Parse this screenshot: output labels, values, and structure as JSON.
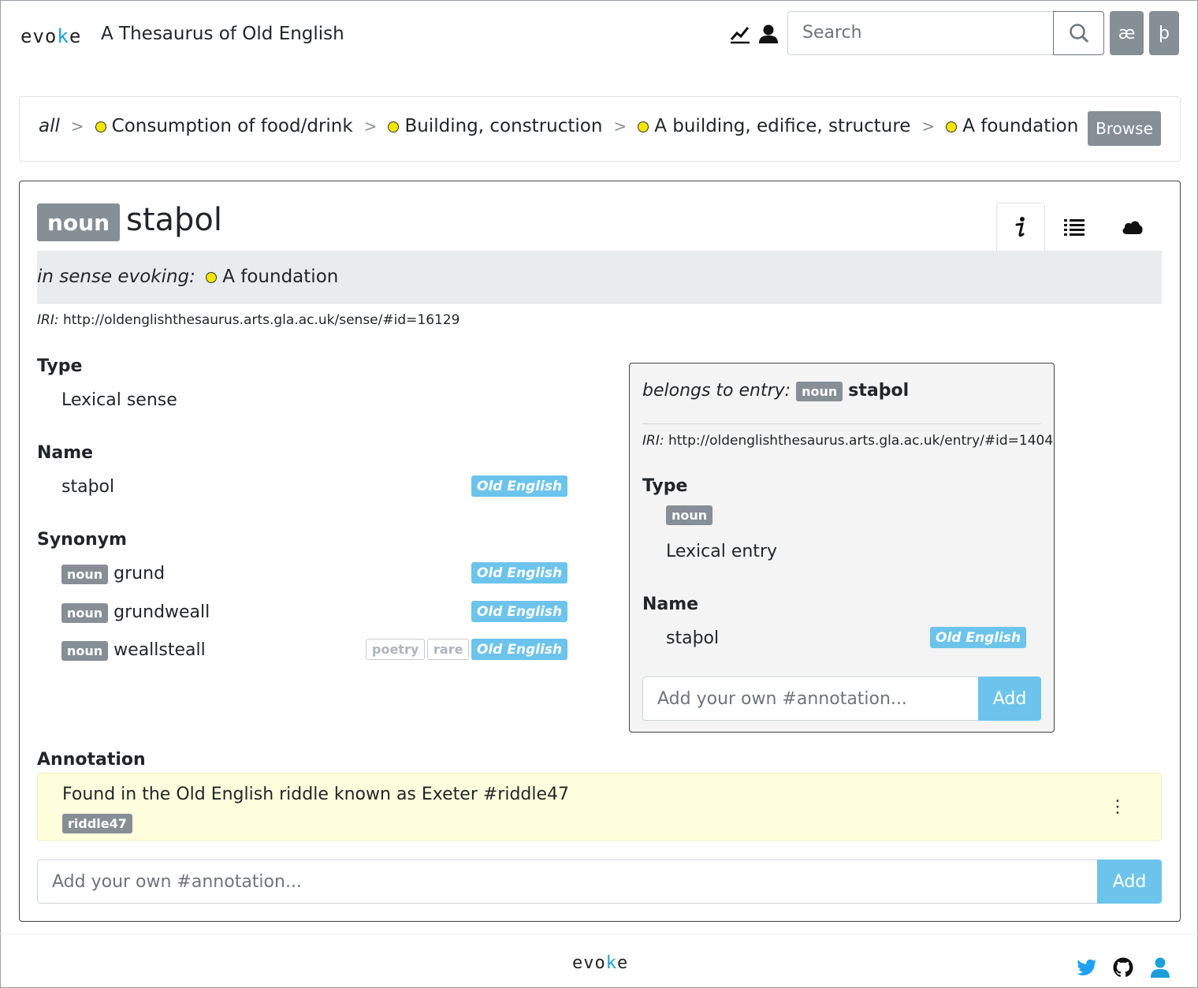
{
  "header": {
    "logo_prefix": "evo",
    "logo_k": "k",
    "logo_suffix": "e",
    "title": "A Thesaurus of Old English",
    "search_placeholder": "Search",
    "char_buttons": [
      "æ",
      "þ"
    ]
  },
  "breadcrumb": {
    "root": "all",
    "separator": ">",
    "items": [
      "Consumption of food/drink",
      "Building, construction",
      "A building, edifice, structure",
      "A foundation"
    ],
    "browse_label": "Browse"
  },
  "sense": {
    "pos": "noun",
    "headword": "staþol",
    "evoking_label": "in sense evoking:",
    "evoking_concept": "A foundation",
    "iri_label": "IRI:",
    "iri": "http://oldenglishthesaurus.arts.gla.ac.uk/sense/#id=16129",
    "type_heading": "Type",
    "type_value": "Lexical sense",
    "name_heading": "Name",
    "name_value": "staþol",
    "name_lang": "Old English",
    "synonym_heading": "Synonym",
    "synonyms": [
      {
        "pos": "noun",
        "word": "grund",
        "tags": [],
        "lang": "Old English"
      },
      {
        "pos": "noun",
        "word": "grundweall",
        "tags": [],
        "lang": "Old English"
      },
      {
        "pos": "noun",
        "word": "weallsteall",
        "tags": [
          "poetry",
          "rare"
        ],
        "lang": "Old English"
      }
    ],
    "annotation_heading": "Annotation",
    "annotation_text": "Found in the Old English riddle known as Exeter #riddle47",
    "annotation_tag": "riddle47",
    "annotation_menu": "⋮",
    "annotation_placeholder": "Add your own #annotation...",
    "add_label": "Add"
  },
  "entry": {
    "belongs_label": "belongs to entry:",
    "pos": "noun",
    "headword": "staþol",
    "iri_label": "IRI:",
    "iri": "http://oldenglishthesaurus.arts.gla.ac.uk/entry/#id=1404",
    "type_heading": "Type",
    "type_badge": "noun",
    "type_value": "Lexical entry",
    "name_heading": "Name",
    "name_value": "staþol",
    "name_lang": "Old English",
    "annotation_placeholder": "Add your own #annotation...",
    "add_label": "Add"
  },
  "footer": {
    "logo_prefix": "evo",
    "logo_k": "k",
    "logo_suffix": "e"
  },
  "colors": {
    "badge_grey": "#868e96",
    "lang_blue": "#6cc4ec",
    "concept_dot": "#f2e600",
    "annotation_bg": "#ffffdd",
    "twitter": "#1da1f2",
    "user_blue": "#1a9fd9"
  }
}
